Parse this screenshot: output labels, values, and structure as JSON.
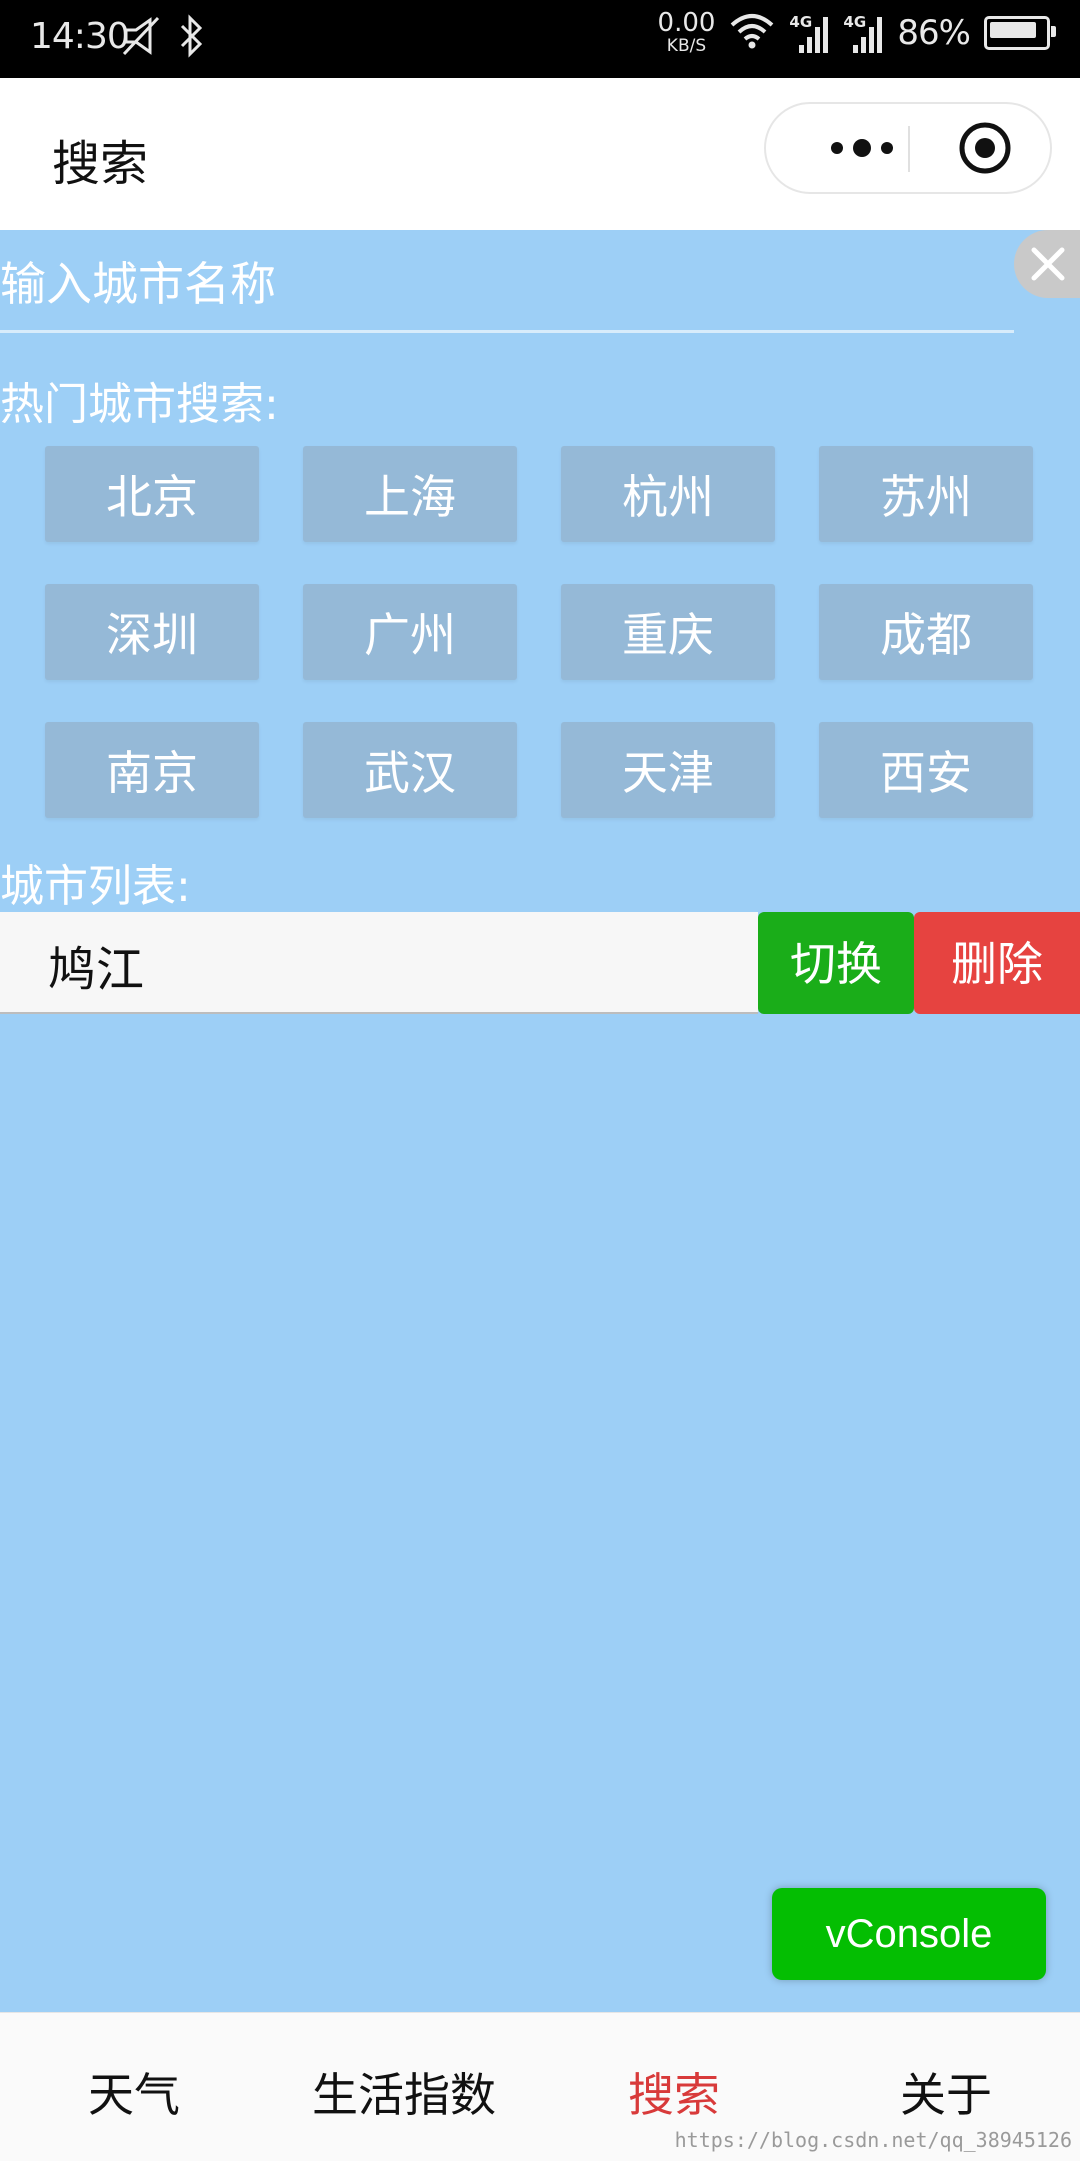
{
  "status_bar": {
    "time": "14:30",
    "net_speed": "0.00",
    "net_unit": "KB/S",
    "signal1": "4G",
    "signal2": "4G",
    "battery": "86%"
  },
  "nav": {
    "title": "搜索"
  },
  "search": {
    "placeholder": "输入城市名称"
  },
  "hot_cities": {
    "label": "热门城市搜索:",
    "items": [
      "北京",
      "上海",
      "杭州",
      "苏州",
      "深圳",
      "广州",
      "重庆",
      "成都",
      "南京",
      "武汉",
      "天津",
      "西安"
    ]
  },
  "city_list": {
    "label": "城市列表:",
    "items": [
      {
        "name": "鸠江",
        "switch_label": "切换",
        "delete_label": "删除"
      }
    ]
  },
  "vconsole": {
    "label": "vConsole"
  },
  "tab_bar": {
    "items": [
      {
        "label": "天气",
        "active": false
      },
      {
        "label": "生活指数",
        "active": false
      },
      {
        "label": "搜索",
        "active": true
      },
      {
        "label": "关于",
        "active": false
      }
    ]
  },
  "watermark": "https://blog.csdn.net/qq_38945126",
  "colors": {
    "page_bg": "#9dcff6",
    "city_button": "#95b9d7",
    "switch": "#1aad19",
    "delete": "#e64340",
    "tab_active": "#d83a3a",
    "vconsole": "#04be02"
  }
}
